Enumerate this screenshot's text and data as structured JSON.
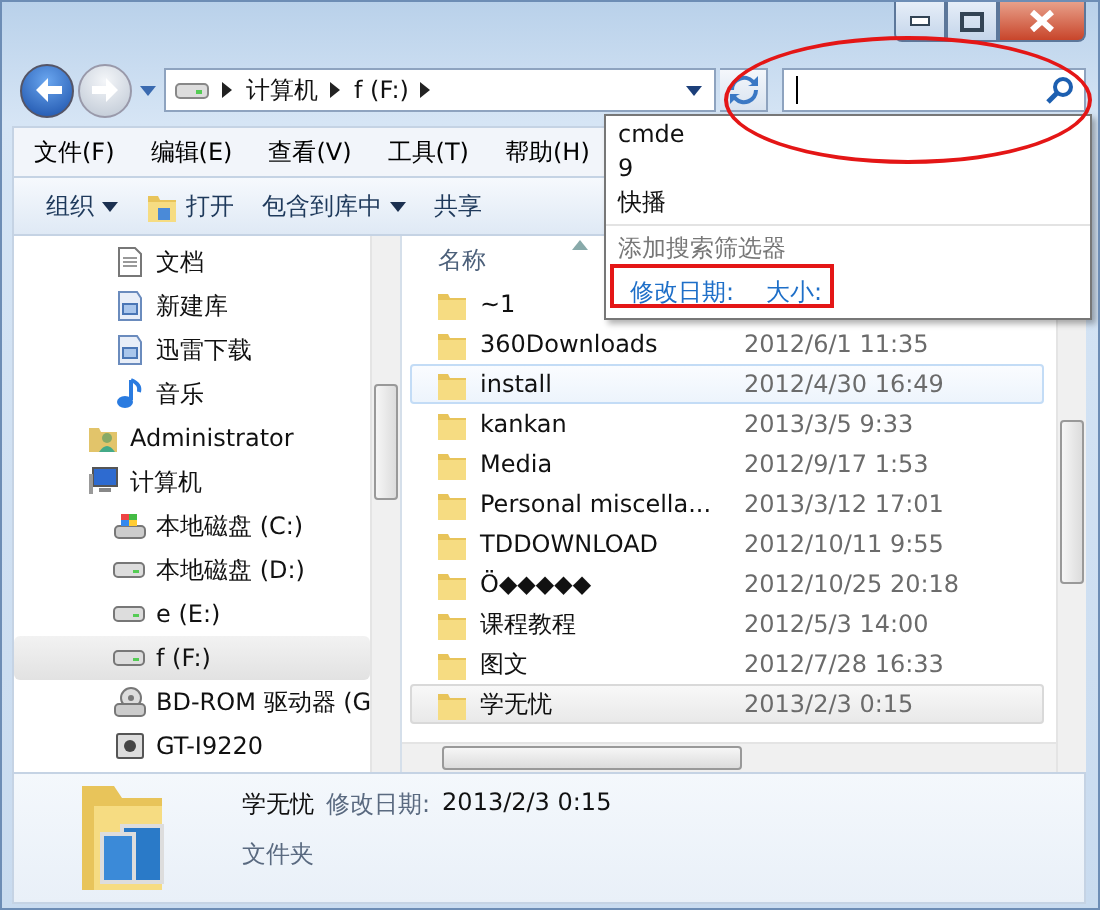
{
  "window": {
    "controls": [
      {
        "kind": "minimize"
      },
      {
        "kind": "maximize"
      },
      {
        "kind": "close"
      }
    ]
  },
  "address_bar": {
    "segments": [
      "计算机",
      "f (F:)"
    ]
  },
  "search_dropdown": {
    "history": [
      "cmde",
      "9",
      "快播"
    ],
    "filter_heading": "添加搜索筛选器",
    "filters": [
      "修改日期:",
      "大小:"
    ]
  },
  "menu": [
    "文件(F)",
    "编辑(E)",
    "查看(V)",
    "工具(T)",
    "帮助(H)"
  ],
  "toolbar": [
    {
      "label": "组织",
      "kind": "dropdown"
    },
    {
      "label": "打开",
      "kind": "open"
    },
    {
      "label": "包含到库中",
      "kind": "dropdown"
    },
    {
      "label": "共享",
      "kind": "plain"
    }
  ],
  "nav_tree": [
    {
      "children": [
        {
          "label": "文档",
          "kind": "document",
          "selected": false
        },
        {
          "label": "新建库",
          "kind": "library",
          "selected": false
        },
        {
          "label": "迅雷下载",
          "kind": "library",
          "selected": false
        },
        {
          "label": "音乐",
          "kind": "music",
          "selected": false
        }
      ]
    },
    {
      "label": "Administrator",
      "kind": "user",
      "selected": false
    },
    {
      "label": "计算机",
      "kind": "computer",
      "selected": false,
      "children": [
        {
          "label": "本地磁盘 (C:)",
          "kind": "system-drive",
          "selected": false
        },
        {
          "label": "本地磁盘 (D:)",
          "kind": "drive",
          "selected": false
        },
        {
          "label": "e (E:)",
          "kind": "drive",
          "selected": false
        },
        {
          "label": "f (F:)",
          "kind": "drive",
          "selected": true
        },
        {
          "label": "BD-ROM 驱动器 (G",
          "kind": "optical-drive",
          "selected": false
        },
        {
          "label": "GT-I9220",
          "kind": "device",
          "selected": false
        }
      ]
    }
  ],
  "file_list": {
    "columns": [
      "名称"
    ],
    "rows": [
      {
        "name": "~1",
        "selected": false,
        "hovered": false
      },
      {
        "name": "360Downloads",
        "date": "2012/6/1 11:35",
        "selected": false,
        "hovered": false
      },
      {
        "name": "install",
        "date": "2012/4/30 16:49",
        "selected": false,
        "hovered": true
      },
      {
        "name": "kankan",
        "date": "2013/3/5 9:33",
        "selected": false,
        "hovered": false
      },
      {
        "name": "Media",
        "date": "2012/9/17 1:53",
        "selected": false,
        "hovered": false
      },
      {
        "name": "Personal miscella...",
        "date": "2013/3/12 17:01",
        "selected": false,
        "hovered": false
      },
      {
        "name": "TDDOWNLOAD",
        "date": "2012/10/11 9:55",
        "selected": false,
        "hovered": false
      },
      {
        "name": "Ö◆◆◆◆◆",
        "date": "2012/10/25 20:18",
        "selected": false,
        "hovered": false
      },
      {
        "name": "课程教程",
        "date": "2012/5/3 14:00",
        "selected": false,
        "hovered": false
      },
      {
        "name": "图文",
        "date": "2012/7/28 16:33",
        "selected": false,
        "hovered": false
      },
      {
        "name": "学无忧",
        "date": "2013/2/3 0:15",
        "selected": true,
        "hovered": false
      }
    ]
  },
  "details": {
    "name": "学无忧",
    "date_label": "修改日期:",
    "date": "2013/2/3 0:15",
    "type": "文件夹"
  },
  "annotations": [
    {
      "kind": "ellipse"
    },
    {
      "kind": "rectangle"
    }
  ]
}
